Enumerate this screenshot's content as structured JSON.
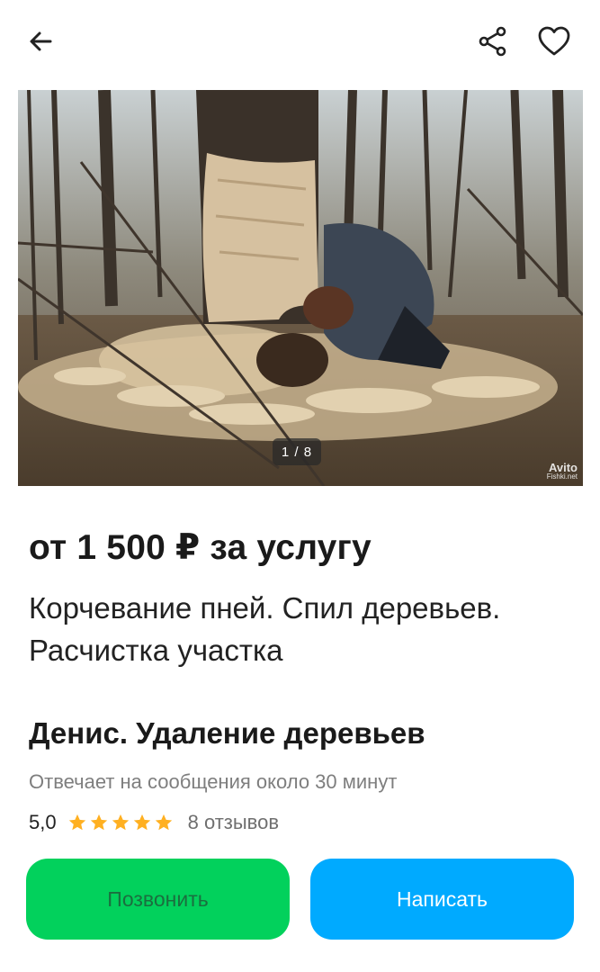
{
  "header": {
    "back_icon": "arrow-left-icon",
    "share_icon": "share-icon",
    "favorite_icon": "heart-outline-icon"
  },
  "gallery": {
    "counter": "1 / 8",
    "current": 1,
    "total": 8,
    "watermark": "Avito",
    "watermark_sub": "Fishki.net"
  },
  "listing": {
    "price": "от 1 500 ₽ за услугу",
    "title": "Корчевание пней. Спил деревьев. Расчистка участка"
  },
  "seller": {
    "name": "Денис. Удаление деревьев",
    "response_time": "Отвечает на сообщения около 30 минут",
    "rating": "5,0",
    "stars": 5,
    "reviews": "8 отзывов"
  },
  "actions": {
    "call_label": "Позвонить",
    "write_label": "Написать"
  },
  "colors": {
    "call_button": "#02d15c",
    "write_button": "#00aaff",
    "star": "#ffb021"
  }
}
